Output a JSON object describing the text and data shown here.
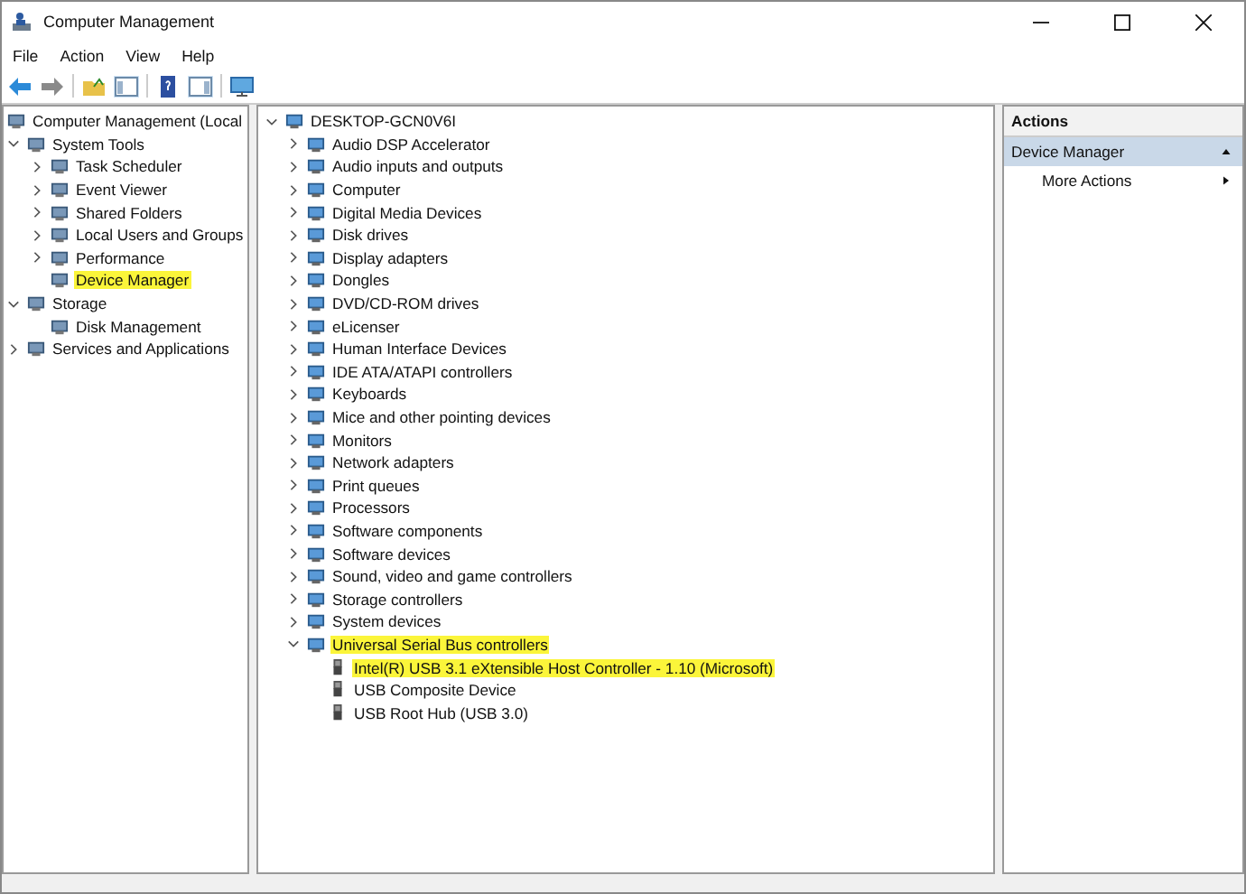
{
  "window": {
    "title": "Computer Management"
  },
  "menu": [
    "File",
    "Action",
    "View",
    "Help"
  ],
  "console_tree": [
    {
      "label": "Computer Management (Local",
      "highlighted": false,
      "children": [
        {
          "label": "System Tools",
          "expanded": true,
          "highlighted": false,
          "children": [
            {
              "label": "Task Scheduler",
              "expanded": false,
              "highlighted": false
            },
            {
              "label": "Event Viewer",
              "expanded": false,
              "highlighted": false
            },
            {
              "label": "Shared Folders",
              "expanded": false,
              "highlighted": false
            },
            {
              "label": "Local Users and Groups",
              "expanded": false,
              "highlighted": false
            },
            {
              "label": "Performance",
              "expanded": false,
              "highlighted": false
            },
            {
              "label": "Device Manager",
              "highlighted": true
            }
          ]
        },
        {
          "label": "Storage",
          "expanded": true,
          "highlighted": false,
          "children": [
            {
              "label": "Disk Management",
              "highlighted": false
            }
          ]
        },
        {
          "label": "Services and Applications",
          "expanded": false,
          "highlighted": false
        }
      ]
    }
  ],
  "device_tree": [
    {
      "label": "DESKTOP-GCN0V6I",
      "expanded": true,
      "highlighted": false,
      "children": [
        {
          "label": "Audio DSP Accelerator",
          "expanded": false,
          "highlighted": false
        },
        {
          "label": "Audio inputs and outputs",
          "expanded": false,
          "highlighted": false
        },
        {
          "label": "Computer",
          "expanded": false,
          "highlighted": false
        },
        {
          "label": "Digital Media Devices",
          "expanded": false,
          "highlighted": false
        },
        {
          "label": "Disk drives",
          "expanded": false,
          "highlighted": false
        },
        {
          "label": "Display adapters",
          "expanded": false,
          "highlighted": false
        },
        {
          "label": "Dongles",
          "expanded": false,
          "highlighted": false
        },
        {
          "label": "DVD/CD-ROM drives",
          "expanded": false,
          "highlighted": false
        },
        {
          "label": "eLicenser",
          "expanded": false,
          "highlighted": false
        },
        {
          "label": "Human Interface Devices",
          "expanded": false,
          "highlighted": false
        },
        {
          "label": "IDE ATA/ATAPI controllers",
          "expanded": false,
          "highlighted": false
        },
        {
          "label": "Keyboards",
          "expanded": false,
          "highlighted": false
        },
        {
          "label": "Mice and other pointing devices",
          "expanded": false,
          "highlighted": false
        },
        {
          "label": "Monitors",
          "expanded": false,
          "highlighted": false
        },
        {
          "label": "Network adapters",
          "expanded": false,
          "highlighted": false
        },
        {
          "label": "Print queues",
          "expanded": false,
          "highlighted": false
        },
        {
          "label": "Processors",
          "expanded": false,
          "highlighted": false
        },
        {
          "label": "Software components",
          "expanded": false,
          "highlighted": false
        },
        {
          "label": "Software devices",
          "expanded": false,
          "highlighted": false
        },
        {
          "label": "Sound, video and game controllers",
          "expanded": false,
          "highlighted": false
        },
        {
          "label": "Storage controllers",
          "expanded": false,
          "highlighted": false
        },
        {
          "label": "System devices",
          "expanded": false,
          "highlighted": false
        },
        {
          "label": "Universal Serial Bus controllers",
          "expanded": true,
          "highlighted": true,
          "children": [
            {
              "label": "Intel(R) USB 3.1 eXtensible Host Controller - 1.10 (Microsoft)",
              "highlighted": true
            },
            {
              "label": "USB Composite Device",
              "highlighted": false
            },
            {
              "label": "USB Root Hub (USB 3.0)",
              "highlighted": false
            }
          ]
        }
      ]
    }
  ],
  "actions": {
    "header": "Actions",
    "section": "Device Manager",
    "items": [
      "More Actions"
    ]
  }
}
